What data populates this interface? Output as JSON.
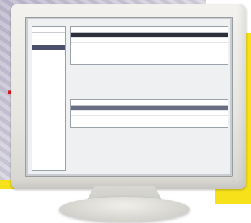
{
  "sidebar": {
    "title": "",
    "items": [
      "",
      "",
      "",
      ""
    ],
    "selected_index": 3
  },
  "upper_table": {
    "headers": [
      "",
      "",
      "",
      "",
      "",
      "",
      ""
    ],
    "rows": [
      [
        "",
        "",
        "",
        "",
        "",
        "",
        ""
      ],
      [
        "",
        "",
        "",
        "",
        "",
        "",
        ""
      ],
      [
        "",
        "",
        "",
        "",
        "",
        "",
        ""
      ]
    ]
  },
  "lower_table": {
    "headers": [
      "",
      "",
      "",
      "",
      "",
      ""
    ],
    "rows": [
      [
        "",
        "",
        "",
        "",
        "",
        ""
      ],
      [
        "",
        "",
        "",
        "",
        "",
        ""
      ],
      [
        "",
        "",
        "",
        "",
        "",
        ""
      ],
      [
        "",
        "",
        "",
        "",
        "",
        ""
      ]
    ]
  },
  "status_bar": {
    "text": ""
  },
  "colors": {
    "accent_yellow": "#f6e11a",
    "selection_dark": "#2d2f3a",
    "selection_mid": "#6a6e84",
    "dot_red": "#e01616"
  }
}
